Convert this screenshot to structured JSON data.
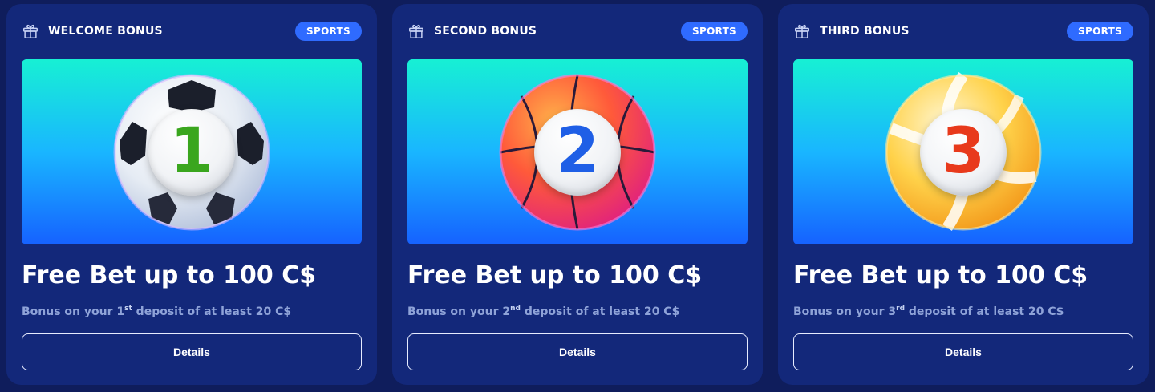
{
  "cards": [
    {
      "title": "WELCOME BONUS",
      "tag": "SPORTS",
      "icon": "gift-icon",
      "ball": "soccer-ball",
      "number": "1",
      "number_color": "#3aa61e",
      "offer": "Free Bet up to 100 C$",
      "sub_before": "Bonus on your 1",
      "sub_ordinal": "st",
      "sub_after": " deposit of at least 20 C$",
      "button": "Details"
    },
    {
      "title": "SECOND BONUS",
      "tag": "SPORTS",
      "icon": "gift-icon",
      "ball": "basketball",
      "number": "2",
      "number_color": "#1f5fe6",
      "offer": "Free Bet up to 100 C$",
      "sub_before": "Bonus on your 2",
      "sub_ordinal": "nd",
      "sub_after": " deposit of at least 20 C$",
      "button": "Details"
    },
    {
      "title": "THIRD BONUS",
      "tag": "SPORTS",
      "icon": "gift-icon",
      "ball": "volleyball",
      "number": "3",
      "number_color": "#e83a1c",
      "offer": "Free Bet up to 100 C$",
      "sub_before": "Bonus on your 3",
      "sub_ordinal": "rd",
      "sub_after": " deposit of at least 20 C$",
      "button": "Details"
    }
  ],
  "colors": {
    "page_bg": "#0f1d5c",
    "card_bg": "#13287a",
    "tag_bg": "#2f6bff",
    "subtext": "#8fa3d8"
  }
}
